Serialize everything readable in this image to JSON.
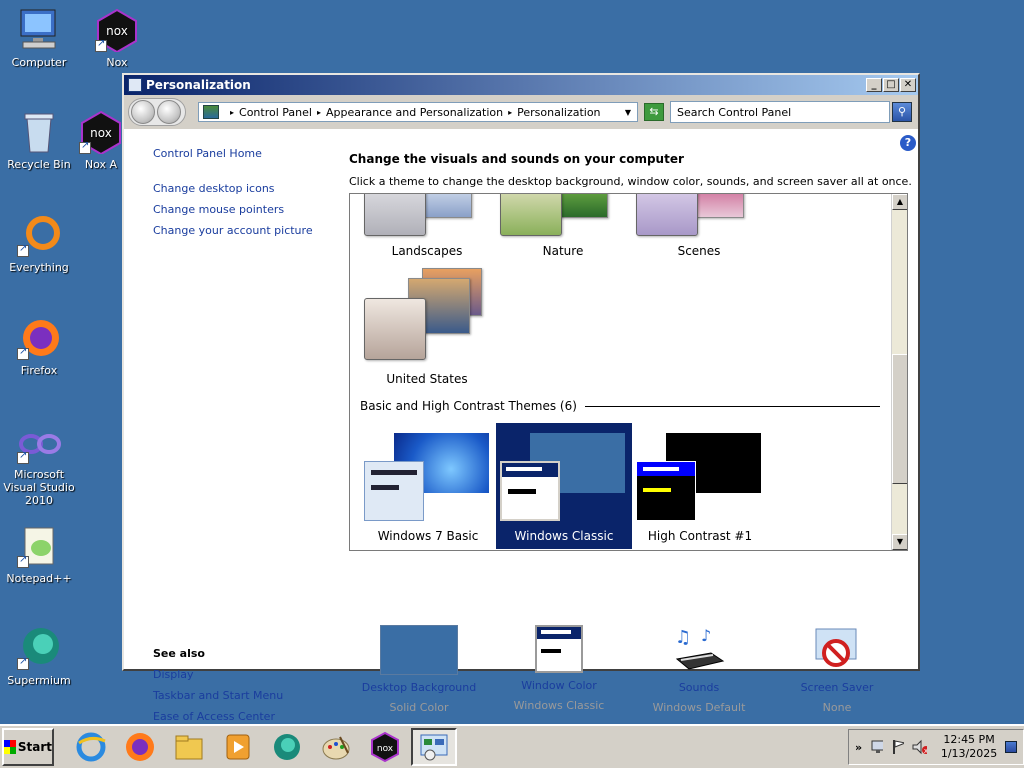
{
  "desktop": {
    "icons": [
      {
        "label": "Computer",
        "icon": "computer-icon"
      },
      {
        "label": "Nox",
        "icon": "nox-icon"
      },
      {
        "label": "Recycle Bin",
        "icon": "recycle-bin-icon"
      },
      {
        "label": "Nox A",
        "icon": "nox-icon"
      },
      {
        "label": "Everything",
        "icon": "everything-icon"
      },
      {
        "label": "Firefox",
        "icon": "firefox-icon"
      },
      {
        "label": "Microsoft Visual Studio 2010",
        "icon": "visual-studio-icon"
      },
      {
        "label": "Notepad++",
        "icon": "notepadpp-icon"
      },
      {
        "label": "Supermium",
        "icon": "supermium-icon"
      }
    ]
  },
  "window": {
    "title": "Personalization",
    "controls": {
      "minimize": "_",
      "maximize": "□",
      "close": "✕"
    },
    "address": {
      "crumbs": [
        "Control Panel",
        "Appearance and Personalization",
        "Personalization"
      ],
      "separator": "▸",
      "dropdown": "▼"
    },
    "search_placeholder": "Search Control Panel",
    "help": "?"
  },
  "leftnav": {
    "home": "Control Panel Home",
    "links": [
      "Change desktop icons",
      "Change mouse pointers",
      "Change your account picture"
    ]
  },
  "main": {
    "heading": "Change the visuals and sounds on your computer",
    "subheading": "Click a theme to change the desktop background, window color, sounds, and screen saver all at once.",
    "themes": [
      "Landscapes",
      "Nature",
      "Scenes",
      "United States"
    ],
    "group_header": "Basic and High Contrast Themes (6)",
    "basic_themes": [
      "Windows 7 Basic",
      "Windows Classic",
      "High Contrast #1"
    ],
    "selected_theme": "Windows Classic"
  },
  "seealso": {
    "title": "See also",
    "links": [
      "Display",
      "Taskbar and Start Menu",
      "Ease of Access Center"
    ]
  },
  "bottom": [
    {
      "label": "Desktop Background",
      "sub": "Solid Color"
    },
    {
      "label": "Window Color",
      "sub": "Windows Classic"
    },
    {
      "label": "Sounds",
      "sub": "Windows Default"
    },
    {
      "label": "Screen Saver",
      "sub": "None"
    }
  ],
  "taskbar": {
    "start": "Start",
    "apps": [
      "internet-explorer-icon",
      "firefox-icon",
      "explorer-icon",
      "media-player-icon",
      "supermium-icon",
      "paint-icon",
      "nox-icon",
      "control-panel-icon"
    ],
    "time": "12:45 PM",
    "date": "1/13/2025",
    "tray_expand": "»"
  },
  "colors": {
    "desktop": "#3a6ea5",
    "titlebar_start": "#0a246a",
    "titlebar_end": "#a6caf0",
    "link": "#1a3d9e",
    "selection": "#0a246a"
  }
}
